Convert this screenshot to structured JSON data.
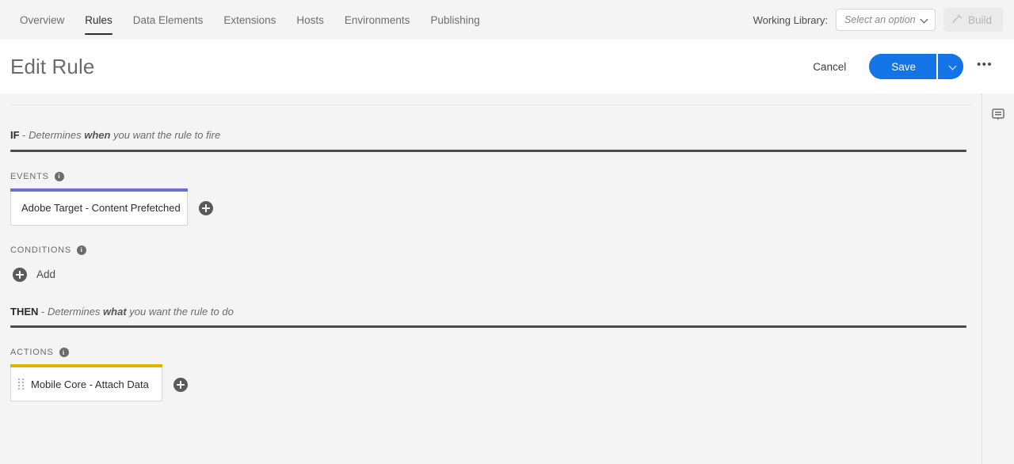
{
  "nav": {
    "tabs": [
      {
        "label": "Overview",
        "active": false
      },
      {
        "label": "Rules",
        "active": true
      },
      {
        "label": "Data Elements",
        "active": false
      },
      {
        "label": "Extensions",
        "active": false
      },
      {
        "label": "Hosts",
        "active": false
      },
      {
        "label": "Environments",
        "active": false
      },
      {
        "label": "Publishing",
        "active": false
      }
    ],
    "working_library_label": "Working Library:",
    "working_library_placeholder": "Select an option",
    "working_library_value": "",
    "build_label": "Build",
    "build_icon": "hammer-icon",
    "build_disabled": true
  },
  "header": {
    "title": "Edit Rule",
    "cancel_label": "Cancel",
    "save_label": "Save",
    "save_caret_icon": "chevron-down-icon",
    "more_label": "•••"
  },
  "body": {
    "if_section": {
      "keyword": "IF",
      "dash": " - ",
      "text_before": "Determines ",
      "emphasis": "when",
      "text_after": " you want the rule to fire"
    },
    "events": {
      "label": "EVENTS",
      "info_icon": "info-icon",
      "info_glyph": "i",
      "accent_color": "#6c6fd8",
      "items": [
        {
          "label": "Adobe Target - Content Prefetched"
        }
      ],
      "add_icon": "plus-circle-icon"
    },
    "conditions": {
      "label": "CONDITIONS",
      "info_icon": "info-icon",
      "info_glyph": "i",
      "add_label": "Add",
      "add_icon": "plus-circle-icon",
      "items": []
    },
    "then_section": {
      "keyword": "THEN",
      "dash": " - ",
      "text_before": "Determines ",
      "emphasis": "what",
      "text_after": " you want the rule to do"
    },
    "actions": {
      "label": "ACTIONS",
      "info_icon": "info-icon",
      "info_glyph": "i",
      "accent_color": "#dbb600",
      "items": [
        {
          "label": "Mobile Core - Attach Data",
          "handle_icon": "drag-handle-icon"
        }
      ],
      "add_icon": "plus-circle-icon"
    }
  },
  "right_rail": {
    "comment_icon": "comment-icon"
  }
}
